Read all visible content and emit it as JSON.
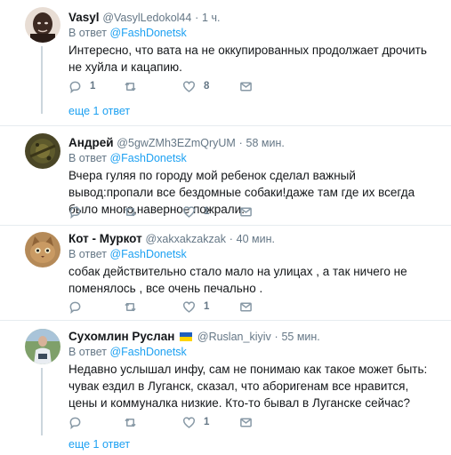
{
  "reply_prefix": "В ответ",
  "tweets": [
    {
      "name": "Vasyl",
      "handle": "@VasylLedokol44",
      "dot": "·",
      "time": "1 ч.",
      "reply_mention": "@FashDonetsk",
      "text": "Интересно, что вата на не оккупированных продолжает дрочить не хуйла и кацапию.",
      "replies": "1",
      "retweets": "",
      "likes": "8",
      "more_replies": "еще 1 ответ"
    },
    {
      "name": "Андрей",
      "handle": "@5gwZMh3EZmQryUM",
      "dot": "·",
      "time": "58 мин.",
      "reply_mention": "@FashDonetsk",
      "text": "Вчера гуляя по городу мой ребенок сделал важный вывод:пропали все бездомные собаки!даже там где их всегда было много,наверное пожрали.",
      "replies": "",
      "retweets": "",
      "likes": "1"
    },
    {
      "name": "Кот - Муркот",
      "handle": "@xakxakzakzak",
      "dot": "·",
      "time": "40 мин.",
      "reply_mention": "@FashDonetsk",
      "text": "собак действительно стало мало на улицах , а так ничего не поменялось , все очень печально .",
      "replies": "",
      "retweets": "",
      "likes": "1"
    },
    {
      "name": "Сухомлин Руслан",
      "handle": "@Ruslan_kiyiv",
      "dot": "·",
      "time": "55 мин.",
      "reply_mention": "@FashDonetsk",
      "text": "Недавно услышал инфу, сам не понимаю как такое может быть: чувак ездил в Луганск, сказал, что аборигенам все нравится, цены и коммуналка низкие. Кто-то бывал в Луганске сейчас?",
      "replies": "",
      "retweets": "",
      "likes": "1",
      "more_replies": "еще 1 ответ"
    }
  ],
  "colors": {
    "link": "#1da1f2",
    "secondary_text": "#657786",
    "icon": "#8899a6",
    "divider": "#e6ecf0",
    "flag_blue": "#1f5fbf",
    "flag_yellow": "#ffd400"
  },
  "icons": {
    "reply": "reply-icon",
    "retweet": "retweet-icon",
    "like": "heart-icon",
    "dm": "envelope-icon"
  }
}
